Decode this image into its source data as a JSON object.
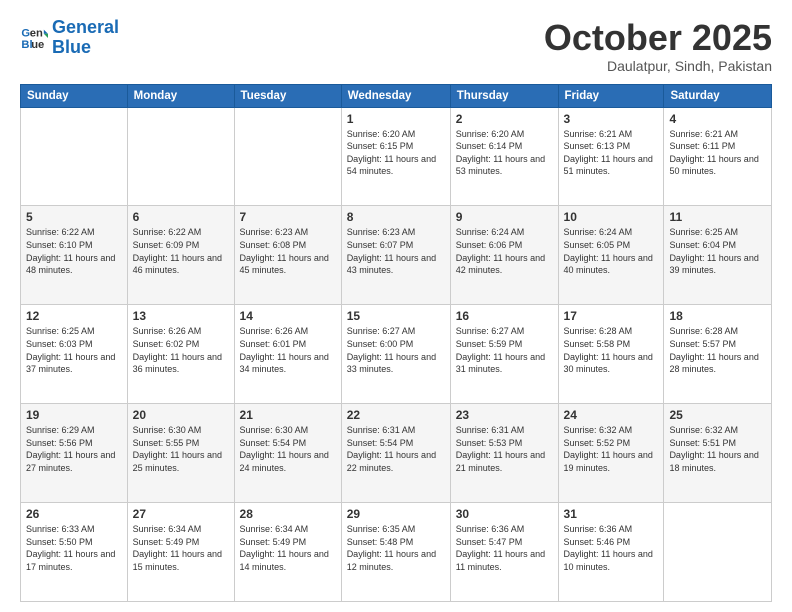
{
  "header": {
    "logo_line1": "General",
    "logo_line2": "Blue",
    "month": "October 2025",
    "location": "Daulatpur, Sindh, Pakistan"
  },
  "weekdays": [
    "Sunday",
    "Monday",
    "Tuesday",
    "Wednesday",
    "Thursday",
    "Friday",
    "Saturday"
  ],
  "weeks": [
    [
      {
        "day": "",
        "sunrise": "",
        "sunset": "",
        "daylight": ""
      },
      {
        "day": "",
        "sunrise": "",
        "sunset": "",
        "daylight": ""
      },
      {
        "day": "",
        "sunrise": "",
        "sunset": "",
        "daylight": ""
      },
      {
        "day": "1",
        "sunrise": "Sunrise: 6:20 AM",
        "sunset": "Sunset: 6:15 PM",
        "daylight": "Daylight: 11 hours and 54 minutes."
      },
      {
        "day": "2",
        "sunrise": "Sunrise: 6:20 AM",
        "sunset": "Sunset: 6:14 PM",
        "daylight": "Daylight: 11 hours and 53 minutes."
      },
      {
        "day": "3",
        "sunrise": "Sunrise: 6:21 AM",
        "sunset": "Sunset: 6:13 PM",
        "daylight": "Daylight: 11 hours and 51 minutes."
      },
      {
        "day": "4",
        "sunrise": "Sunrise: 6:21 AM",
        "sunset": "Sunset: 6:11 PM",
        "daylight": "Daylight: 11 hours and 50 minutes."
      }
    ],
    [
      {
        "day": "5",
        "sunrise": "Sunrise: 6:22 AM",
        "sunset": "Sunset: 6:10 PM",
        "daylight": "Daylight: 11 hours and 48 minutes."
      },
      {
        "day": "6",
        "sunrise": "Sunrise: 6:22 AM",
        "sunset": "Sunset: 6:09 PM",
        "daylight": "Daylight: 11 hours and 46 minutes."
      },
      {
        "day": "7",
        "sunrise": "Sunrise: 6:23 AM",
        "sunset": "Sunset: 6:08 PM",
        "daylight": "Daylight: 11 hours and 45 minutes."
      },
      {
        "day": "8",
        "sunrise": "Sunrise: 6:23 AM",
        "sunset": "Sunset: 6:07 PM",
        "daylight": "Daylight: 11 hours and 43 minutes."
      },
      {
        "day": "9",
        "sunrise": "Sunrise: 6:24 AM",
        "sunset": "Sunset: 6:06 PM",
        "daylight": "Daylight: 11 hours and 42 minutes."
      },
      {
        "day": "10",
        "sunrise": "Sunrise: 6:24 AM",
        "sunset": "Sunset: 6:05 PM",
        "daylight": "Daylight: 11 hours and 40 minutes."
      },
      {
        "day": "11",
        "sunrise": "Sunrise: 6:25 AM",
        "sunset": "Sunset: 6:04 PM",
        "daylight": "Daylight: 11 hours and 39 minutes."
      }
    ],
    [
      {
        "day": "12",
        "sunrise": "Sunrise: 6:25 AM",
        "sunset": "Sunset: 6:03 PM",
        "daylight": "Daylight: 11 hours and 37 minutes."
      },
      {
        "day": "13",
        "sunrise": "Sunrise: 6:26 AM",
        "sunset": "Sunset: 6:02 PM",
        "daylight": "Daylight: 11 hours and 36 minutes."
      },
      {
        "day": "14",
        "sunrise": "Sunrise: 6:26 AM",
        "sunset": "Sunset: 6:01 PM",
        "daylight": "Daylight: 11 hours and 34 minutes."
      },
      {
        "day": "15",
        "sunrise": "Sunrise: 6:27 AM",
        "sunset": "Sunset: 6:00 PM",
        "daylight": "Daylight: 11 hours and 33 minutes."
      },
      {
        "day": "16",
        "sunrise": "Sunrise: 6:27 AM",
        "sunset": "Sunset: 5:59 PM",
        "daylight": "Daylight: 11 hours and 31 minutes."
      },
      {
        "day": "17",
        "sunrise": "Sunrise: 6:28 AM",
        "sunset": "Sunset: 5:58 PM",
        "daylight": "Daylight: 11 hours and 30 minutes."
      },
      {
        "day": "18",
        "sunrise": "Sunrise: 6:28 AM",
        "sunset": "Sunset: 5:57 PM",
        "daylight": "Daylight: 11 hours and 28 minutes."
      }
    ],
    [
      {
        "day": "19",
        "sunrise": "Sunrise: 6:29 AM",
        "sunset": "Sunset: 5:56 PM",
        "daylight": "Daylight: 11 hours and 27 minutes."
      },
      {
        "day": "20",
        "sunrise": "Sunrise: 6:30 AM",
        "sunset": "Sunset: 5:55 PM",
        "daylight": "Daylight: 11 hours and 25 minutes."
      },
      {
        "day": "21",
        "sunrise": "Sunrise: 6:30 AM",
        "sunset": "Sunset: 5:54 PM",
        "daylight": "Daylight: 11 hours and 24 minutes."
      },
      {
        "day": "22",
        "sunrise": "Sunrise: 6:31 AM",
        "sunset": "Sunset: 5:54 PM",
        "daylight": "Daylight: 11 hours and 22 minutes."
      },
      {
        "day": "23",
        "sunrise": "Sunrise: 6:31 AM",
        "sunset": "Sunset: 5:53 PM",
        "daylight": "Daylight: 11 hours and 21 minutes."
      },
      {
        "day": "24",
        "sunrise": "Sunrise: 6:32 AM",
        "sunset": "Sunset: 5:52 PM",
        "daylight": "Daylight: 11 hours and 19 minutes."
      },
      {
        "day": "25",
        "sunrise": "Sunrise: 6:32 AM",
        "sunset": "Sunset: 5:51 PM",
        "daylight": "Daylight: 11 hours and 18 minutes."
      }
    ],
    [
      {
        "day": "26",
        "sunrise": "Sunrise: 6:33 AM",
        "sunset": "Sunset: 5:50 PM",
        "daylight": "Daylight: 11 hours and 17 minutes."
      },
      {
        "day": "27",
        "sunrise": "Sunrise: 6:34 AM",
        "sunset": "Sunset: 5:49 PM",
        "daylight": "Daylight: 11 hours and 15 minutes."
      },
      {
        "day": "28",
        "sunrise": "Sunrise: 6:34 AM",
        "sunset": "Sunset: 5:49 PM",
        "daylight": "Daylight: 11 hours and 14 minutes."
      },
      {
        "day": "29",
        "sunrise": "Sunrise: 6:35 AM",
        "sunset": "Sunset: 5:48 PM",
        "daylight": "Daylight: 11 hours and 12 minutes."
      },
      {
        "day": "30",
        "sunrise": "Sunrise: 6:36 AM",
        "sunset": "Sunset: 5:47 PM",
        "daylight": "Daylight: 11 hours and 11 minutes."
      },
      {
        "day": "31",
        "sunrise": "Sunrise: 6:36 AM",
        "sunset": "Sunset: 5:46 PM",
        "daylight": "Daylight: 11 hours and 10 minutes."
      },
      {
        "day": "",
        "sunrise": "",
        "sunset": "",
        "daylight": ""
      }
    ]
  ]
}
